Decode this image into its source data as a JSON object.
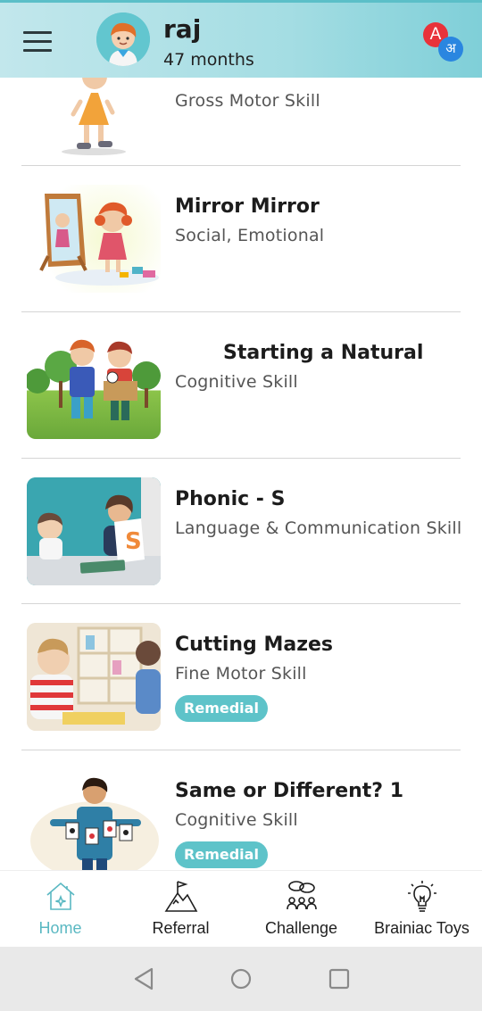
{
  "header": {
    "child_name": "raj",
    "child_age": "47 months",
    "lang_primary": "A",
    "lang_secondary": "अ"
  },
  "activities": [
    {
      "title": "",
      "skill": "Gross Motor Skill",
      "badge": "",
      "thumb": "walking-child-illustration"
    },
    {
      "title": "Mirror Mirror",
      "skill": "Social, Emotional",
      "badge": "",
      "thumb": "girl-mirror-illustration"
    },
    {
      "title": "Starting a Natural",
      "skill": "Cognitive Skill",
      "badge": "",
      "thumb": "two-boys-box-illustration"
    },
    {
      "title": "Phonic - S",
      "skill": "Language & Communication Skill",
      "badge": "",
      "thumb": "teacher-letter-card-photo"
    },
    {
      "title": "Cutting Mazes",
      "skill": "Fine Motor Skill",
      "badge": "Remedial",
      "thumb": "kids-cutting-photo"
    },
    {
      "title": "Same or Different? 1",
      "skill": "Cognitive Skill",
      "badge": "Remedial",
      "thumb": "man-playing-cards-illustration"
    }
  ],
  "bottom_nav": [
    {
      "label": "Home",
      "icon": "home-icon",
      "active": true
    },
    {
      "label": "Referral",
      "icon": "mountain-flag-icon",
      "active": false
    },
    {
      "label": "Challenge",
      "icon": "group-chat-icon",
      "active": false
    },
    {
      "label": "Brainiac Toys",
      "icon": "lightbulb-icon",
      "active": false
    }
  ],
  "system_nav": [
    "back-icon",
    "home-circle-icon",
    "recents-icon"
  ],
  "colors": {
    "accent": "#5ec3c9",
    "header_start": "#c2e7ec",
    "header_end": "#7fcfd8",
    "nav_active": "#5ab8c2"
  }
}
